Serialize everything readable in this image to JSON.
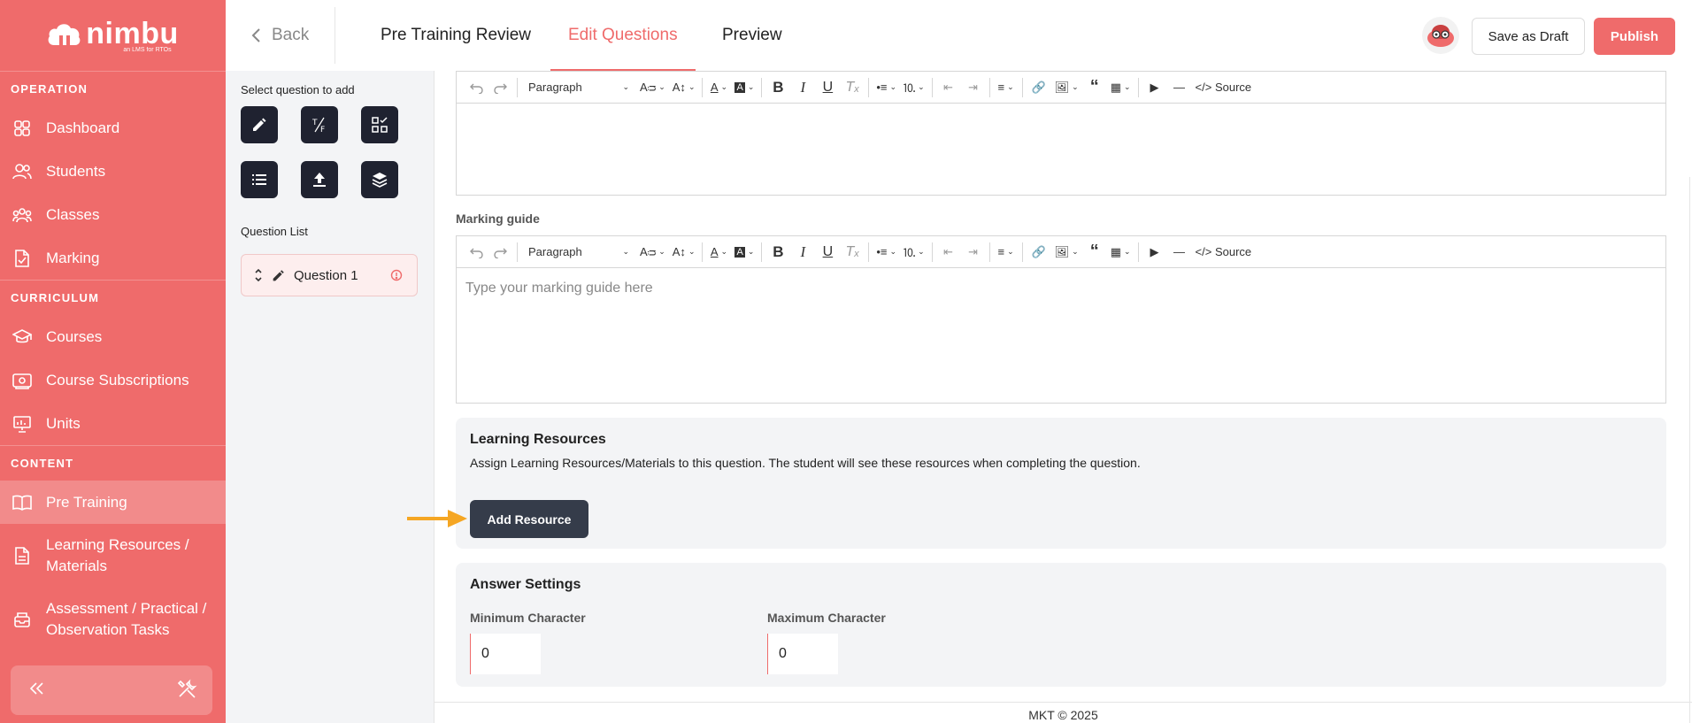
{
  "sidebar": {
    "logo_text": "nimbu",
    "logo_sub": "an LMS for RTOs",
    "sections": {
      "operation": "OPERATION",
      "curriculum": "CURRICULUM",
      "content": "CONTENT"
    },
    "items": {
      "dashboard": "Dashboard",
      "students": "Students",
      "classes": "Classes",
      "marking": "Marking",
      "courses": "Courses",
      "course_subscriptions": "Course Subscriptions",
      "units": "Units",
      "pre_training": "Pre Training",
      "learning_resources": "Learning Resources / Materials",
      "assessment": "Assessment / Practical / Observation Tasks"
    },
    "active_item": "pre_training"
  },
  "header": {
    "back_label": "Back",
    "tabs": [
      "Pre Training Review",
      "Edit Questions",
      "Preview"
    ],
    "active_tab": "Edit Questions",
    "save_draft_label": "Save as Draft",
    "publish_label": "Publish"
  },
  "question_panel": {
    "select_title": "Select question to add",
    "question_types": [
      "pencil-icon",
      "true-false-icon",
      "grid-check-icon",
      "list-icon",
      "upload-icon",
      "layers-icon"
    ],
    "list_title": "Question List",
    "questions": [
      {
        "label": "Question 1",
        "has_error": true
      }
    ]
  },
  "editor_toolbar": {
    "paragraph_label": "Paragraph",
    "source_label": "Source"
  },
  "marking_guide": {
    "label": "Marking guide",
    "placeholder": "Type your marking guide here"
  },
  "learning_resources": {
    "title": "Learning Resources",
    "description": "Assign Learning Resources/Materials to this question. The student will see these resources when completing the question.",
    "add_button": "Add Resource"
  },
  "answer_settings": {
    "title": "Answer Settings",
    "min_label": "Minimum Character",
    "min_value": "0",
    "max_label": "Maximum Character",
    "max_value": "0"
  },
  "footer": {
    "text": "MKT © 2025"
  },
  "colors": {
    "brand": "#ef6b6b",
    "dark_button": "#353c4a",
    "arrow": "#f5a623"
  }
}
